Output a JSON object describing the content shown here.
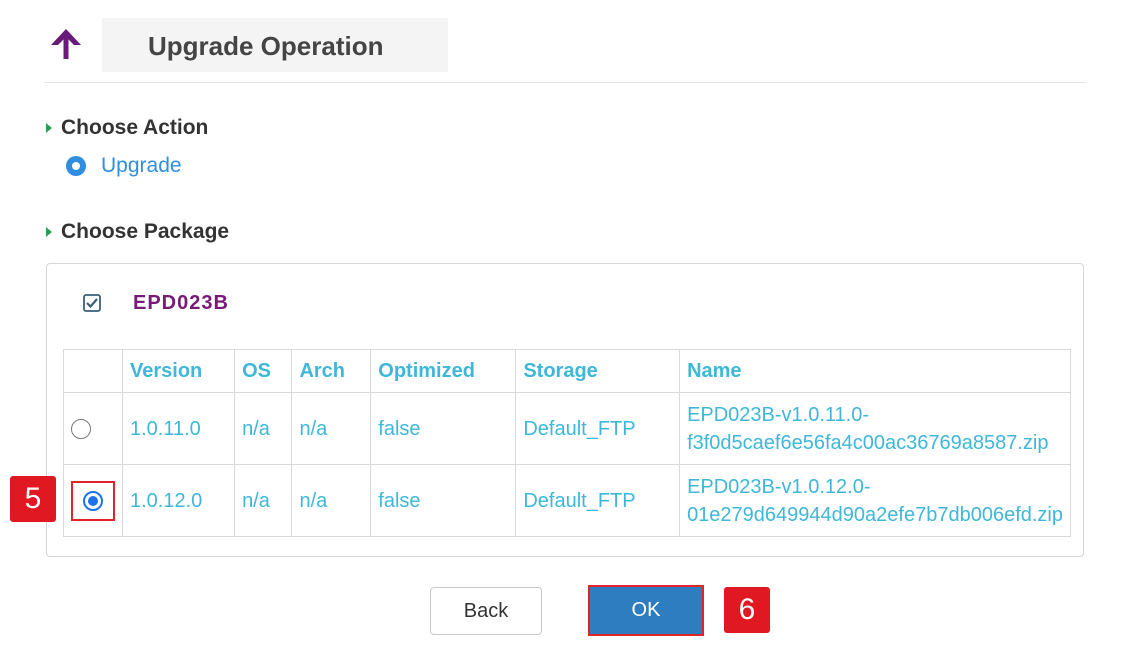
{
  "header": {
    "title": "Upgrade Operation",
    "icon": "up-arrow-icon"
  },
  "sections": {
    "choose_action": "Choose Action",
    "choose_package": "Choose Package"
  },
  "action": {
    "selected_label": "Upgrade"
  },
  "package": {
    "name": "EPD023B",
    "checked": true,
    "columns": [
      "Version",
      "OS",
      "Arch",
      "Optimized",
      "Storage",
      "Name"
    ],
    "rows": [
      {
        "selected": false,
        "version": "1.0.11.0",
        "os": "n/a",
        "arch": "n/a",
        "optimized": "false",
        "storage": "Default_FTP",
        "name_line1": "EPD023B-v1.0.11.0-",
        "name_line2": "f3f0d5caef6e56fa4c00ac36769a8587.zip"
      },
      {
        "selected": true,
        "version": "1.0.12.0",
        "os": "n/a",
        "arch": "n/a",
        "optimized": "false",
        "storage": "Default_FTP",
        "name_line1": "EPD023B-v1.0.12.0-",
        "name_line2": "01e279d649944d90a2efe7b7db006efd.zip"
      }
    ]
  },
  "buttons": {
    "back": "Back",
    "ok": "OK"
  },
  "callouts": {
    "step5": "5",
    "step6": "6"
  },
  "colors": {
    "accent_blue": "#2f8ee0",
    "table_text": "#3eb7d8",
    "package_name": "#7a1a78",
    "ok_button": "#2e7dc0",
    "callout_red": "#e01822",
    "section_marker": "#2a9d5c"
  }
}
